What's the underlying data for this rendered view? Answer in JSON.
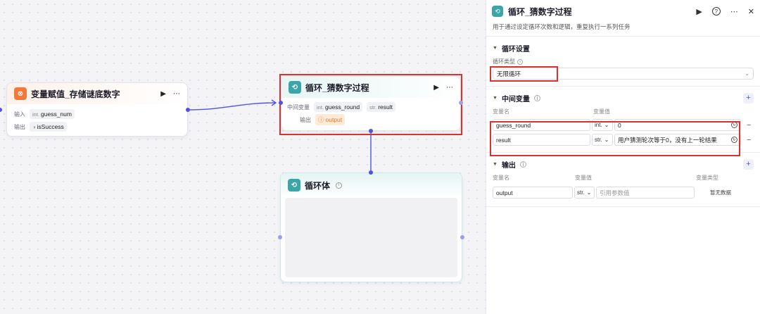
{
  "canvas": {
    "assign_node": {
      "title": "变量赋值_存储谜底数字",
      "input_label": "输入",
      "input_type": "int.",
      "input_value": "guess_num",
      "output_label": "输出",
      "output_value": "isSuccess"
    },
    "loop_node": {
      "title": "循环_猜数字过程",
      "mid_label": "中间变量",
      "var1_type": "int.",
      "var1": "guess_round",
      "var2_type": "str.",
      "var2": "result",
      "output_label": "输出",
      "output_value": "output"
    },
    "loop_body": {
      "title": "循环体"
    }
  },
  "panel": {
    "title": "循环_猜数字过程",
    "description": "用于通过设定循环次数和逻辑，重复执行一系列任务",
    "loop_settings": {
      "title": "循环设置",
      "type_label": "循环类型",
      "type_value": "无限循环"
    },
    "intermediate": {
      "title": "中间变量",
      "col_name": "变量名",
      "col_value": "变量值",
      "rows": [
        {
          "name": "guess_round",
          "type": "int.",
          "value": "0"
        },
        {
          "name": "result",
          "type": "str.",
          "value": "用户猜测轮次等于0，没有上一轮结果"
        }
      ]
    },
    "output": {
      "title": "输出",
      "col_name": "变量名",
      "col_value": "变量值",
      "col_type": "变量类型",
      "rows": [
        {
          "name": "output",
          "type": "str.",
          "placeholder": "引用参数值",
          "var_type": "暂无数据"
        }
      ]
    }
  },
  "colors": {
    "accent": "#4d53e8",
    "highlight_red": "#d9322f",
    "loop_icon": "#3ba5a8",
    "assign_icon": "#f2793a"
  },
  "icons": [
    "loop-icon",
    "assign-icon",
    "play-icon",
    "more-icon",
    "help-icon",
    "close-icon",
    "info-icon",
    "plus-icon",
    "chevron-down-icon"
  ]
}
